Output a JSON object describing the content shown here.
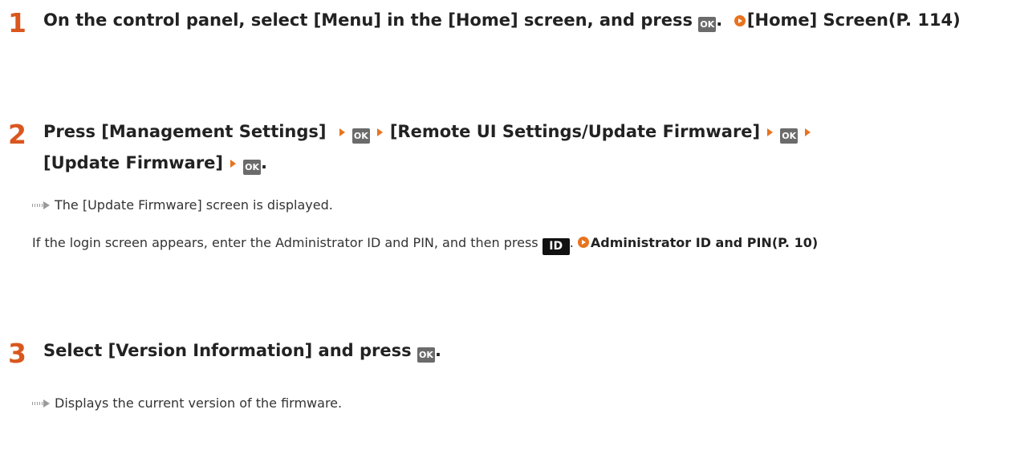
{
  "steps": [
    {
      "number": "1",
      "text_a": "On the control panel, select [Menu] in the [Home] screen, and press",
      "ok_after_a": "OK",
      "period": ".",
      "link": "[Home] Screen(P. 114)"
    },
    {
      "number": "2",
      "seg1": "Press [Management Settings]",
      "seg2": "[Remote UI Settings/Update Firmware]",
      "seg3": "[Update Firmware]",
      "ok_label": "OK",
      "period": ".",
      "result": "The [Update Firmware] screen is displayed.",
      "note_text": "If the login screen appears, enter the Administrator ID and PIN, and then press",
      "id_key": "ID",
      "note_period": ".",
      "note_link": "Administrator ID and PIN(P. 10)"
    },
    {
      "number": "3",
      "text": "Select [Version Information] and press",
      "ok_label": "OK",
      "period": ".",
      "result": "Displays the current version of the firmware."
    }
  ],
  "colors": {
    "step_number": "#d9571f",
    "arrow_accent": "#e8731f",
    "ok_key_bg": "#6b6b6b"
  },
  "icons": [
    "ok-key-icon",
    "right-triangle-icon",
    "link-arrow-icon",
    "id-key-icon",
    "result-arrow-icon"
  ]
}
